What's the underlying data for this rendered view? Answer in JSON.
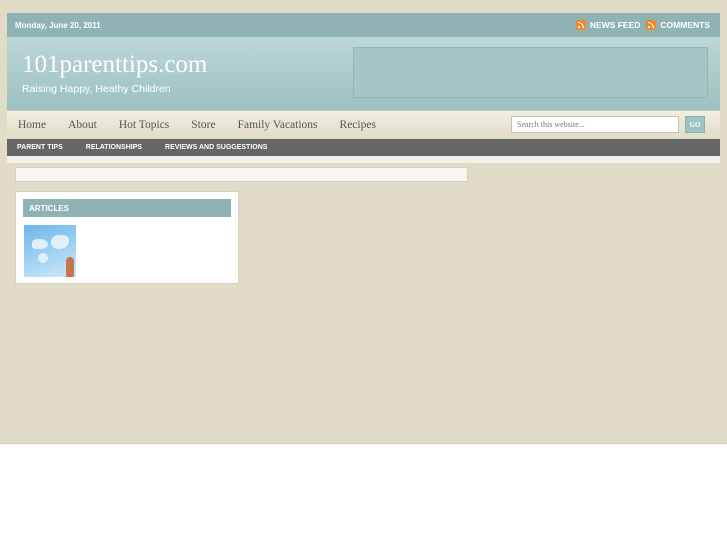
{
  "topbar": {
    "date": "Monday, June 20, 2011",
    "feeds": [
      {
        "label": "NEWS FEED",
        "icon": "rss-icon"
      },
      {
        "label": "COMMENTS",
        "icon": "rss-icon"
      }
    ]
  },
  "header": {
    "title": "101parenttips.com",
    "description": "Raising Happy, Heathy Children"
  },
  "nav": {
    "items": [
      "Home",
      "About",
      "Hot Topics",
      "Store",
      "Family Vacations",
      "Recipes"
    ],
    "search_placeholder": "Search this website...",
    "go_label": "GO"
  },
  "subnav": {
    "items": [
      "PARENT TIPS",
      "RELATIONSHIPS",
      "REVIEWS AND SUGGESTIONS"
    ]
  },
  "sidebar": {
    "widget_title": "ARTICLES"
  },
  "colors": {
    "accent": "#8fb3b4",
    "page_bg": "#e1dcc8",
    "subnav_bg": "#666666",
    "rss": "#f0892c"
  }
}
